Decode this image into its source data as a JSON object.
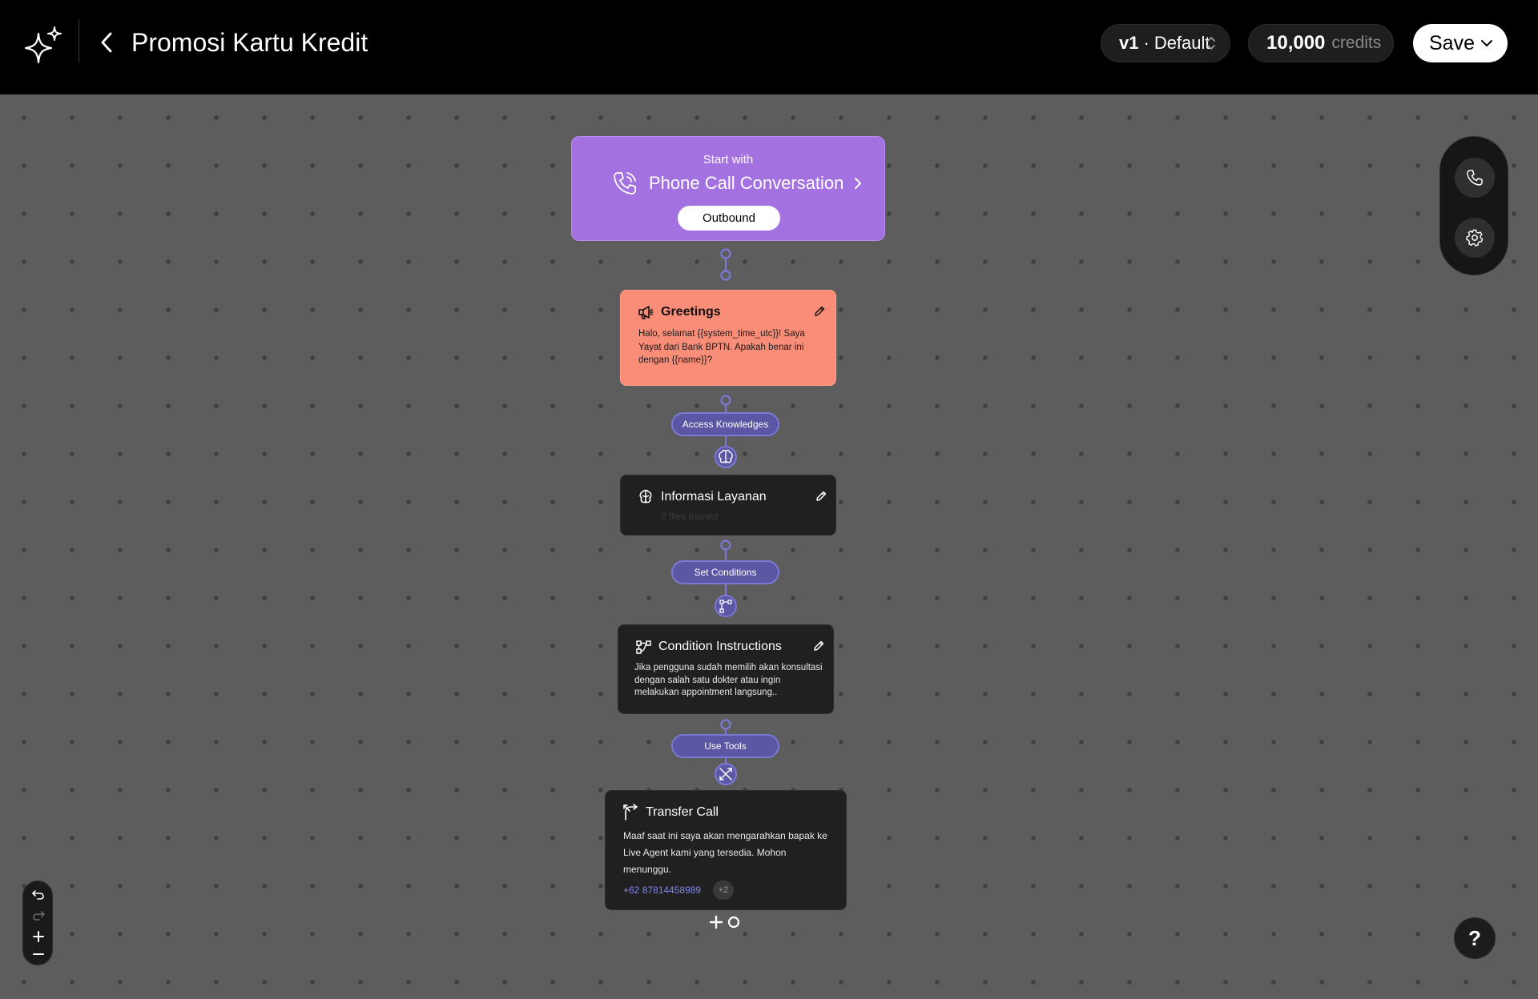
{
  "header": {
    "title": "Promosi Kartu Kredit",
    "version": {
      "label": "v1",
      "separator": "·",
      "name": "Default"
    },
    "credits": {
      "amount": "10,000",
      "label": "credits"
    },
    "save_label": "Save"
  },
  "start": {
    "caption": "Start with",
    "channel": "Phone Call Conversation",
    "direction": "Outbound"
  },
  "nodes": {
    "greetings": {
      "title": "Greetings",
      "text": "Halo, selamat {{system_time_utc}}! Saya Yayat dari Bank BPTN. Apakah benar ini dengan {{name}}?"
    },
    "knowledge_link": "Access Knowledges",
    "info": {
      "title": "Informasi Layanan",
      "subtitle": "2 files trained"
    },
    "conditions_link": "Set Conditions",
    "condition": {
      "title": "Condition Instructions",
      "text": "Jika pengguna sudah memilih akan konsultasi dengan salah satu dokter atau ingin melakukan appointment langsung.."
    },
    "tools_link": "Use Tools",
    "transfer": {
      "title": "Transfer Call",
      "text": "Maaf saat ini saya akan mengarahkan bapak ke Live Agent kami yang tersedia. Mohon menunggu.",
      "phone": "+62 87814458989",
      "more": "+2"
    }
  },
  "help_label": "?",
  "colors": {
    "accent_purple": "#a472e0",
    "greeting_salmon": "#fa8d78",
    "connector": "#7c78d6",
    "node_dark": "#202020"
  },
  "icons": {
    "logo": "sparkle-icon",
    "back": "chevron-left-icon",
    "phone": "phone-call-icon",
    "megaphone": "megaphone-icon",
    "brain": "brain-icon",
    "branch": "branch-icon",
    "tools": "tools-icon",
    "transfer": "transfer-arrow-icon",
    "edit": "pencil-icon",
    "gear": "gear-icon"
  }
}
